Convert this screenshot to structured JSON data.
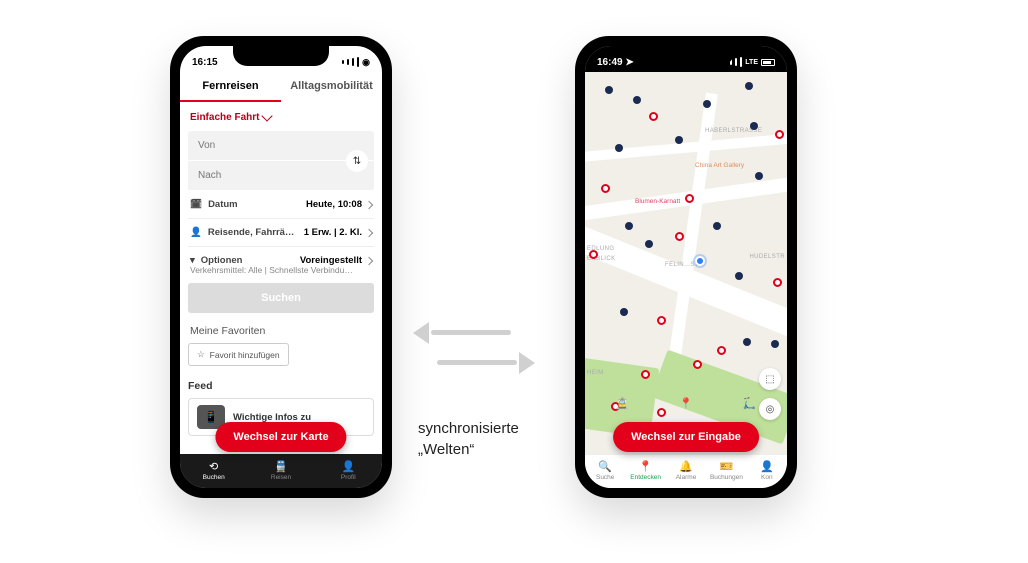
{
  "center_label": {
    "line1": "synchronisierte",
    "line2": "„Welten“"
  },
  "left_phone": {
    "status": {
      "time": "16:15"
    },
    "tabs": [
      {
        "label": "Fernreisen",
        "active": true
      },
      {
        "label": "Alltagsmobilität",
        "active": false
      }
    ],
    "trip_type": "Einfache Fahrt",
    "from_placeholder": "Von",
    "to_placeholder": "Nach",
    "rows": {
      "date": {
        "label": "Datum",
        "value": "Heute, 10:08"
      },
      "travelers": {
        "label": "Reisende, Fahrrä…",
        "value": "1 Erw. | 2. Kl."
      },
      "options": {
        "label": "Optionen",
        "value": "Voreingestellt",
        "sub": "Verkehrsmittel: Alle | Schnellste Verbindu…"
      }
    },
    "search_btn": "Suchen",
    "favorites": {
      "heading": "Meine Favoriten",
      "add_label": "Favorit hinzufügen"
    },
    "feed": {
      "heading": "Feed",
      "card_title": "Wichtige Infos zu"
    },
    "float_btn": "Wechsel zur Karte",
    "bottomnav": [
      {
        "label": "Buchen",
        "active": true
      },
      {
        "label": "Reisen",
        "active": false
      },
      {
        "label": "Profil",
        "active": false
      }
    ]
  },
  "right_phone": {
    "status": {
      "time": "16:49",
      "net": "LTE"
    },
    "float_btn": "Wechsel zur Eingabe",
    "labels": {
      "siedlung": "EDLUNG",
      "blick": "ENBLICK",
      "heim": "HEIM",
      "haberl": "HABERLSTRASSE",
      "hudel": "HUDELSTR",
      "felin": "FELIN…STR"
    },
    "poi": {
      "china": "China Art Gallery",
      "blumen": "Blumen-Karnatt"
    },
    "bottomnav": [
      {
        "label": "Suche",
        "active": false
      },
      {
        "label": "Entdecken",
        "active": true
      },
      {
        "label": "Alarme",
        "active": false
      },
      {
        "label": "Buchungen",
        "active": false
      },
      {
        "label": "Kon",
        "active": false
      }
    ]
  }
}
